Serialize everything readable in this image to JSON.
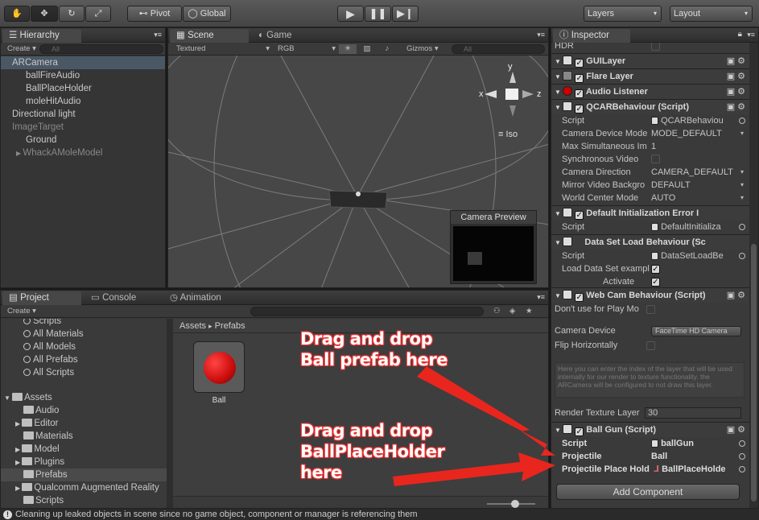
{
  "toolbar": {
    "pivot_label": "Pivot",
    "global_label": "Global",
    "layers_label": "Layers",
    "layout_label": "Layout"
  },
  "hierarchy": {
    "tab_label": "Hierarchy",
    "create_label": "Create",
    "search_placeholder": "All",
    "items": [
      {
        "label": "ARCamera"
      },
      {
        "label": "ballFireAudio"
      },
      {
        "label": "BallPlaceHolder"
      },
      {
        "label": "moleHitAudio"
      },
      {
        "label": "Directional light"
      },
      {
        "label": "ImageTarget"
      },
      {
        "label": "Ground"
      },
      {
        "label": "WhackAMoleModel"
      }
    ]
  },
  "scene": {
    "tab_scene": "Scene",
    "tab_game": "Game",
    "render_mode": "Textured",
    "color_mode": "RGB",
    "gizmos_label": "Gizmos",
    "search_placeholder": "All",
    "iso_label": "Iso",
    "axis_x": "x",
    "axis_y": "y",
    "axis_z": "z",
    "camera_preview_label": "Camera Preview"
  },
  "project": {
    "tab_project": "Project",
    "tab_console": "Console",
    "tab_animation": "Animation",
    "create_label": "Create",
    "tree": [
      {
        "label": "Scripts"
      },
      {
        "label": "All Materials"
      },
      {
        "label": "All Models"
      },
      {
        "label": "All Prefabs"
      },
      {
        "label": "All Scripts"
      },
      {
        "label": "Assets"
      },
      {
        "label": "Audio"
      },
      {
        "label": "Editor"
      },
      {
        "label": "Materials"
      },
      {
        "label": "Model"
      },
      {
        "label": "Plugins"
      },
      {
        "label": "Prefabs"
      },
      {
        "label": "Qualcomm Augmented Reality"
      },
      {
        "label": "Scripts"
      }
    ],
    "breadcrumb_root": "Assets",
    "breadcrumb_sep": "▸",
    "breadcrumb_current": "Prefabs",
    "asset_label": "Ball"
  },
  "inspector": {
    "tab_label": "Inspector",
    "hdr_label": "HDR",
    "guilayer": "GUILayer",
    "flarelayer": "Flare Layer",
    "audiolistener": "Audio Listener",
    "qcar_title": "QCARBehaviour (Script)",
    "qcar_rows": [
      {
        "label": "Script",
        "value": "QCARBehaviou"
      },
      {
        "label": "Camera Device Mode",
        "value": "MODE_DEFAULT"
      },
      {
        "label": "Max Simultaneous Im",
        "value": "1"
      },
      {
        "label": "Synchronous Video",
        "value": ""
      },
      {
        "label": "Camera Direction",
        "value": "CAMERA_DEFAULT"
      },
      {
        "label": "Mirror Video Backgro",
        "value": "DEFAULT"
      },
      {
        "label": "World Center Mode",
        "value": "AUTO"
      }
    ],
    "default_init_title": "Default Initialization Error I",
    "default_init_script_label": "Script",
    "default_init_script_value": "DefaultInitializa",
    "dataset_title": "Data Set Load Behaviour (Sc",
    "dataset_script_label": "Script",
    "dataset_script_value": "DataSetLoadBe",
    "dataset_load_label": "Load Data Set exampl",
    "dataset_activate_label": "Activate",
    "webcam_title": "Web Cam Behaviour (Script)",
    "webcam_dont_use": "Don't use for Play Mo",
    "webcam_camera_device_label": "Camera Device",
    "webcam_camera_device_value": "FaceTime HD Camera",
    "webcam_flip_label": "Flip Horizontally",
    "webcam_help": "Here you can enter the index of the layer that will be used internally for our render to texture functionality. the ARCamera will be configured to not draw this layer.",
    "webcam_render_label": "Render Texture Layer",
    "webcam_render_value": "30",
    "ballgun_title": "Ball Gun (Script)",
    "ballgun_script_label": "Script",
    "ballgun_script_value": "ballGun",
    "ballgun_projectile_label": "Projectile",
    "ballgun_projectile_value": "Ball",
    "ballgun_placehold_label": "Projectile Place Hold",
    "ballgun_placehold_value": "BallPlaceHolde",
    "add_component": "Add Component"
  },
  "annotations": {
    "a1_line1": "Drag and drop",
    "a1_line2": "Ball prefab here",
    "a2_line1": "Drag and drop",
    "a2_line2": "BallPlaceHolder",
    "a2_line3": "here"
  },
  "status_text": "Cleaning up leaked objects in scene since no game object, component or manager is referencing them",
  "colors": {
    "arrow": "#e8261e",
    "selection": "#4a5866"
  }
}
